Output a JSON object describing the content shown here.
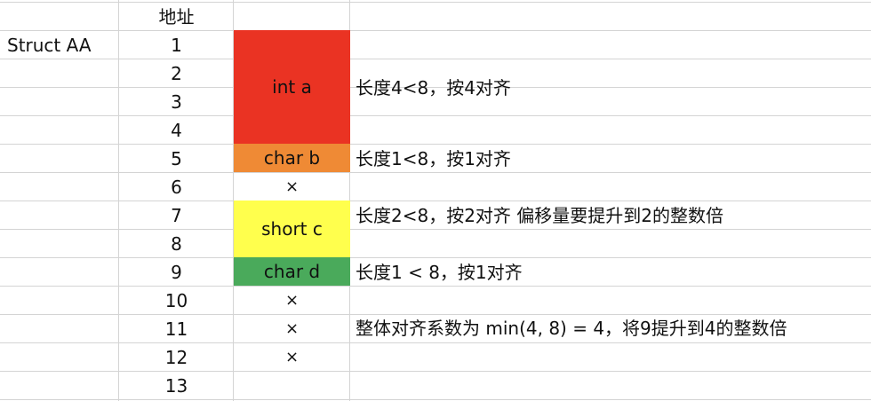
{
  "sheet": {
    "header_label": "地址",
    "struct_label": "Struct AA",
    "addresses": [
      "1",
      "2",
      "3",
      "4",
      "5",
      "6",
      "7",
      "8",
      "9",
      "10",
      "11",
      "12",
      "13"
    ],
    "fields": [
      {
        "label": "int a",
        "color": "#ea3323"
      },
      {
        "label": "char b",
        "color": "#ef8a35"
      },
      {
        "label": "short c",
        "color": "#ffff4d"
      },
      {
        "label": "char d",
        "color": "#4aaa5b"
      }
    ],
    "padding_marks": [
      "×",
      "×",
      "×",
      "×"
    ],
    "notes": [
      "长度4<8，按4对齐",
      "长度1<8，按1对齐",
      "长度2<8，按2对齐 偏移量要提升到2的整数倍",
      "长度1 < 8，按1对齐",
      "整体对齐系数为 min(4, 8) = 4，将9提升到4的整数倍"
    ]
  }
}
